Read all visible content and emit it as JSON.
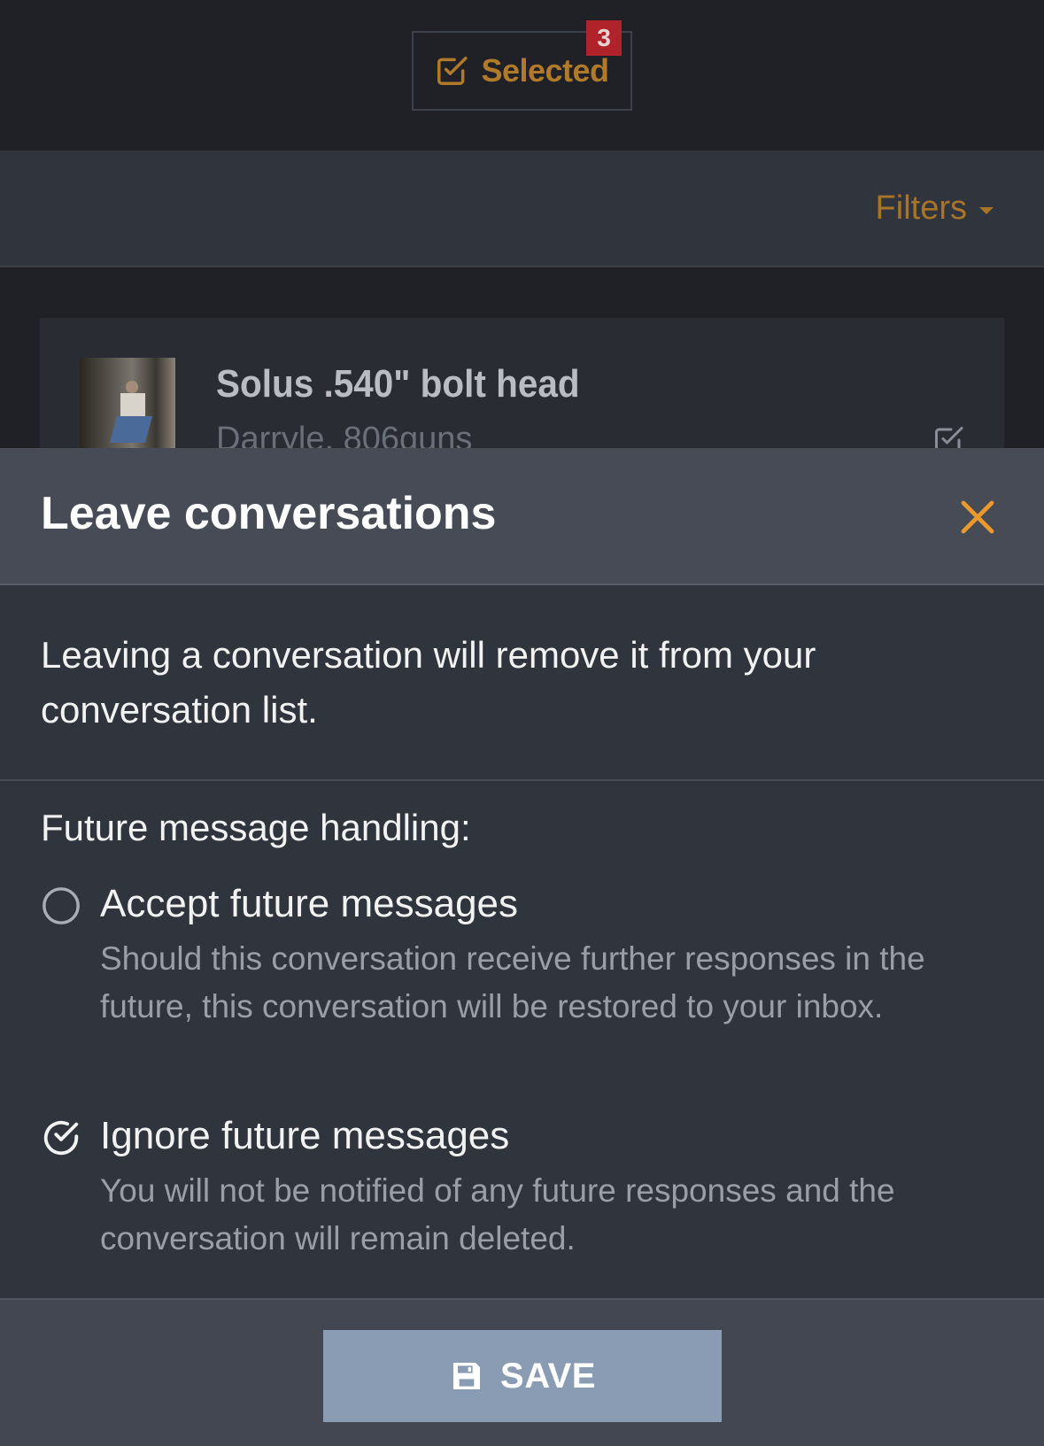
{
  "topbar": {
    "selected_label": "Selected",
    "selected_count": "3",
    "icons": {
      "selected": "checkbox-checked-icon"
    },
    "colors": {
      "accent": "#b07a2a",
      "badge": "#b0232a"
    }
  },
  "filters": {
    "label": "Filters",
    "icon": "caret-down-icon"
  },
  "list": {
    "items": [
      {
        "title": "Solus .540\" bolt head",
        "subtitle": "Darryle, 806guns",
        "checked": true
      }
    ]
  },
  "modal": {
    "title": "Leave conversations",
    "close_icon": "close-icon",
    "intro": "Leaving a conversation will remove it from your conversation list.",
    "section_label": "Future message handling:",
    "options": [
      {
        "title": "Accept future messages",
        "description": "Should this conversation receive further responses in the future, this conversation will be restored to your inbox.",
        "selected": false
      },
      {
        "title": "Ignore future messages",
        "description": "You will not be notified of any future responses and the conversation will remain deleted.",
        "selected": true
      }
    ],
    "save_label": "SAVE",
    "save_icon": "floppy-disk-icon",
    "colors": {
      "close": "#e89a2c",
      "save_button": "#8a9cb4"
    }
  }
}
